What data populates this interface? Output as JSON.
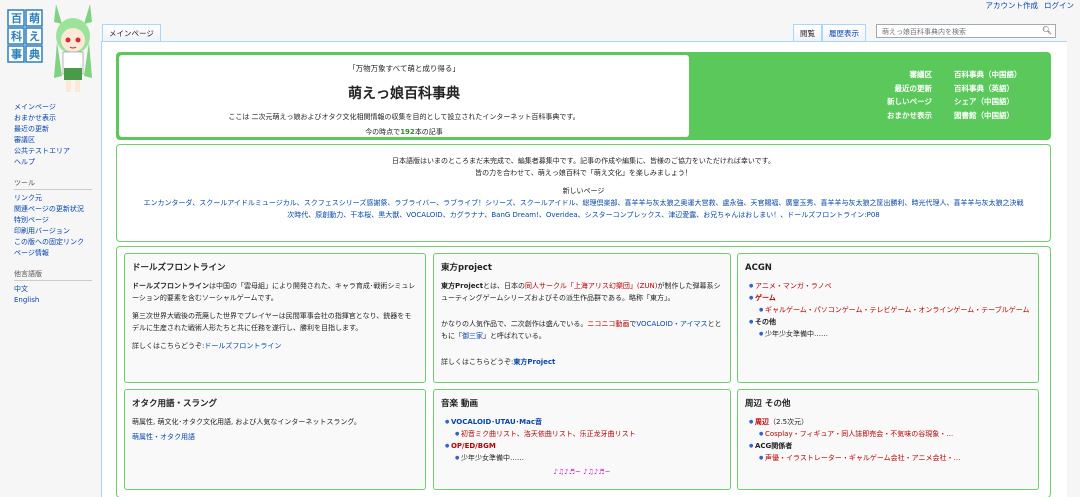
{
  "personal": {
    "create_account": "アカウント作成",
    "login": "ログイン"
  },
  "logo": {
    "text": "萌えっ娘百科事典"
  },
  "sidebar": {
    "main": [
      "メインページ",
      "おまかせ表示",
      "最近の更新",
      "審議区",
      "公共テストエリア",
      "ヘルプ"
    ],
    "tools_heading": "ツール",
    "tools": [
      "リンク元",
      "関連ページの更新状況",
      "特別ページ",
      "印刷用バージョン",
      "この版への固定リンク",
      "ページ情報"
    ],
    "lang_heading": "他言語版",
    "langs": [
      "中文",
      "English"
    ]
  },
  "tabs": {
    "main_page": "メインページ",
    "read": "閲覧",
    "history": "履歴表示"
  },
  "search": {
    "placeholder": "萌えっ娘百科事典内を検索"
  },
  "header": {
    "motto": "「万物万象すべて萌と成り得る」",
    "title": "萌えっ娘百科事典",
    "description": "ここは 二次元萌えっ娘およびオタク文化相関情報の収集を目的として設立されたインターネット百科事典です。",
    "count_prefix": "今の時点で",
    "count": "192",
    "count_suffix": "本の記事",
    "links": [
      [
        "審議区",
        "百科事典（中国語）"
      ],
      [
        "最近の更新",
        "百科事典（英語）"
      ],
      [
        "新しいページ",
        "シェア（中国語）"
      ],
      [
        "おまかせ表示",
        "図書館（中国語）"
      ]
    ]
  },
  "notice": {
    "line1": "日本語版はいまのところまだ未完成で、編集者募集中です。記事の作成や編集に、皆様のご協力をいただければ幸いです。",
    "line2": "皆の力を合わせて、萌えっ娘百科で「萌え文化」を楽しみましょう！",
    "new_pages_heading": "新しいページ",
    "new_pages_line1": "エンカンターダ、スクールアイドルミュージカル、スクフェスシリーズ感謝祭、ラブライバー、ラブライブ！シリーズ、スクールアイドル、総理倶楽部、喜羊羊与灰太狼之奥運大営救、盧永強、天官賜福、廣霊玉秀、喜羊羊与灰太狼之筐出勝利、時光代理人、喜羊羊与灰太狼之決戦",
    "new_pages_line2": "次時代、原創動力、干本桜、黒大獣、VOCALOID、カグラナナ、BanG Dream!、Overidea、シスターコンプレックス、津辺愛露、お兄ちゃんはおしまい！、ドールズフロントライン:P08"
  },
  "panels": {
    "dolls": {
      "title": "ドールズフロントライン",
      "p1_bold": "ドールズフロントライン",
      "p1": "は中国の「雲母組」により開発された、キャラ育成･戦術シミュレーション的要素を含むソーシャルゲームです。",
      "p2": "第三次世界大戦後の荒廃した世界でプレイヤーは民間軍事会社の指揮官となり、銃器をモデルに生産された戦術人形たちと共に任務を遂行し、勝利を目指します。",
      "more_prefix": "詳しくはこちらどうぞ:",
      "more_link": "ドールズフロントライン"
    },
    "touhou": {
      "title": "東方project",
      "p1_bold": "東方Project",
      "p1_a": "とは、日本の",
      "p1_link1": "同人サークル「上海アリス幻樂団」(ZUN)",
      "p1_b": "が制作した弾幕系シューティングゲームシリーズおよびその派生作品群である。略称「東方」。",
      "p2_a": "かなりの人気作品で、二次創作は盛んでいる。",
      "p2_link1": "ニコニコ動画",
      "p2_b": "で",
      "p2_link2": "VOCALOID・アイマス",
      "p2_c": "とともに「",
      "p2_link3": "御三家",
      "p2_d": "」と呼ばれている。",
      "more_prefix": "詳しくはこちらどうぞ:",
      "more_link": "東方Project"
    },
    "acgn": {
      "title": "ACGN",
      "item1": "アニメ・マンガ・ラノベ",
      "item2": "ゲーム",
      "item2_sub": "ギャルゲーム・パソコンゲーム・テレビゲーム・オンラインゲーム・テーブルゲーム",
      "item3": "その他",
      "item3_sub": "少年少女準備中……"
    },
    "otaku": {
      "title": "オタク用語・スラング",
      "desc": "萌属性, 萌文化･オタク文化用語, および人気なインターネットスラング。",
      "links": "萌属性・オタク用語"
    },
    "music": {
      "title": "音楽 動画",
      "item1": "VOCALOID･UTAU･Mac音",
      "item1_sub": "初音ミク曲リスト、洛天依曲リスト、乐正龙牙曲リスト",
      "item2": "OP/ED/BGM",
      "item2_sub": "少年少女準備中……",
      "notes": "♪♫♪♬~ ♪♫♪♬~"
    },
    "around": {
      "title": "周辺 その他",
      "item1": "周辺",
      "item1_suffix": "（2.5次元）",
      "item1_sub": "Cosplay・フィギュア・同人誌即売会・不気味の谷現象・…",
      "item2": "ACG関係者",
      "item2_sub": "声優・イラストレーター・ギャルゲーム会社・アニメ会社・…"
    }
  },
  "colors": {
    "accent_green": "#5ac85a",
    "border_green": "#6fcf6f",
    "link_blue": "#0645ad",
    "link_red": "#ba0000"
  }
}
